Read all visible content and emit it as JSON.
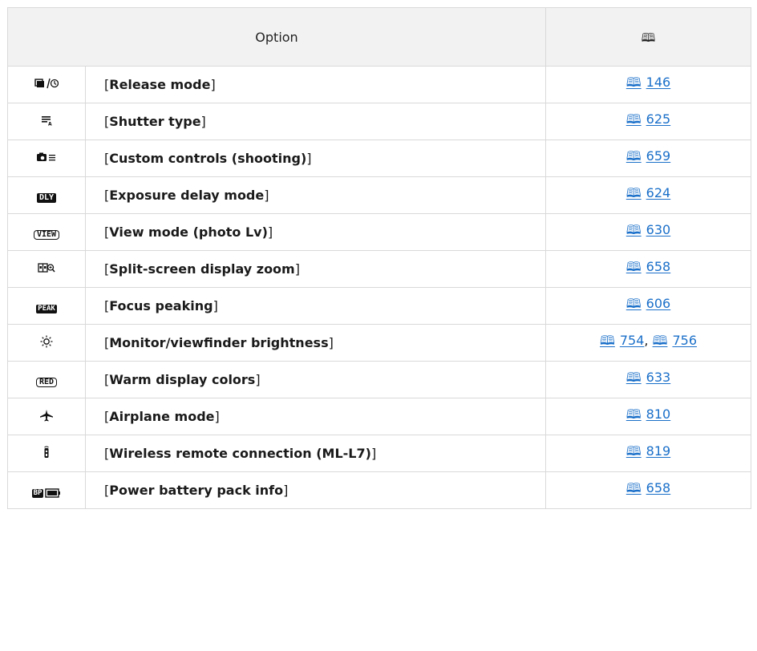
{
  "header": {
    "option_label": "Option",
    "page_icon": "book-icon",
    "page_glyph": "🕮"
  },
  "rows": [
    {
      "icon": "release-mode-icon",
      "name": "Release mode",
      "pages": [
        "146"
      ]
    },
    {
      "icon": "shutter-type-icon",
      "name": "Shutter type",
      "pages": [
        "625"
      ]
    },
    {
      "icon": "custom-controls-icon",
      "name": "Custom controls (shooting)",
      "pages": [
        "659"
      ]
    },
    {
      "icon": "exposure-delay-icon",
      "icon_text": "DLY",
      "name": "Exposure delay mode",
      "pages": [
        "624"
      ]
    },
    {
      "icon": "view-mode-icon",
      "icon_text": "VIEW",
      "name": "View mode (photo Lv)",
      "pages": [
        "630"
      ]
    },
    {
      "icon": "split-screen-zoom-icon",
      "name": "Split-screen display zoom",
      "pages": [
        "658"
      ]
    },
    {
      "icon": "focus-peaking-icon",
      "icon_text": "PEAK",
      "name": "Focus peaking",
      "pages": [
        "606"
      ]
    },
    {
      "icon": "brightness-icon",
      "name": "Monitor/viewfinder brightness",
      "pages": [
        "754",
        "756"
      ]
    },
    {
      "icon": "warm-display-icon",
      "icon_text": "RED",
      "name": "Warm display colors",
      "pages": [
        "633"
      ]
    },
    {
      "icon": "airplane-icon",
      "name": "Airplane mode",
      "pages": [
        "810"
      ]
    },
    {
      "icon": "wireless-remote-icon",
      "name": "Wireless remote connection (ML-L7)",
      "pages": [
        "819"
      ]
    },
    {
      "icon": "battery-pack-icon",
      "icon_text": "BP",
      "name": "Power battery pack info",
      "pages": [
        "658"
      ]
    }
  ],
  "colors": {
    "link": "#1a6fc9",
    "header_bg": "#f2f2f2",
    "border": "#d9d9d9"
  }
}
